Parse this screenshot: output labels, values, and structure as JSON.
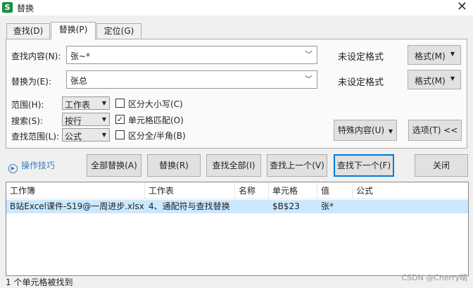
{
  "window": {
    "logo": "S",
    "title": "替换",
    "close": "✕"
  },
  "tabs": [
    {
      "label": "查找(D)"
    },
    {
      "label": "替换(P)"
    },
    {
      "label": "定位(G)"
    }
  ],
  "find": {
    "label": "查找内容(N):",
    "value": "张~*",
    "format_status": "未设定格式",
    "format_button": "格式(M)"
  },
  "replace": {
    "label": "替换为(E):",
    "value": "张总",
    "format_status": "未设定格式",
    "format_button": "格式(M)"
  },
  "options": {
    "scope": {
      "label": "范围(H):",
      "value": "工作表"
    },
    "search": {
      "label": "搜索(S):",
      "value": "按行"
    },
    "look_in": {
      "label": "查找范围(L):",
      "value": "公式"
    },
    "match_case": {
      "label": "区分大小写(C)",
      "checked": false
    },
    "match_cell": {
      "label": "单元格匹配(O)",
      "checked": true
    },
    "match_width": {
      "label": "区分全/半角(B)",
      "checked": false
    },
    "special_button": "特殊内容(U)",
    "options_button": "选项(T) <<"
  },
  "actions": {
    "tips": "操作技巧",
    "replace_all": "全部替换(A)",
    "replace": "替换(R)",
    "find_all": "查找全部(I)",
    "find_prev": "查找上一个(V)",
    "find_next": "查找下一个(F)",
    "close": "关闭"
  },
  "results": {
    "columns": [
      "工作簿",
      "工作表",
      "名称",
      "单元格",
      "值",
      "公式"
    ],
    "rows": [
      [
        "B站Excel课件-S19@一周进步.xlsx",
        "4、通配符与查找替换",
        "",
        "$B$23",
        "张*",
        ""
      ]
    ]
  },
  "status": "1 个单元格被找到",
  "watermark": "CSDN @Cherry晴"
}
